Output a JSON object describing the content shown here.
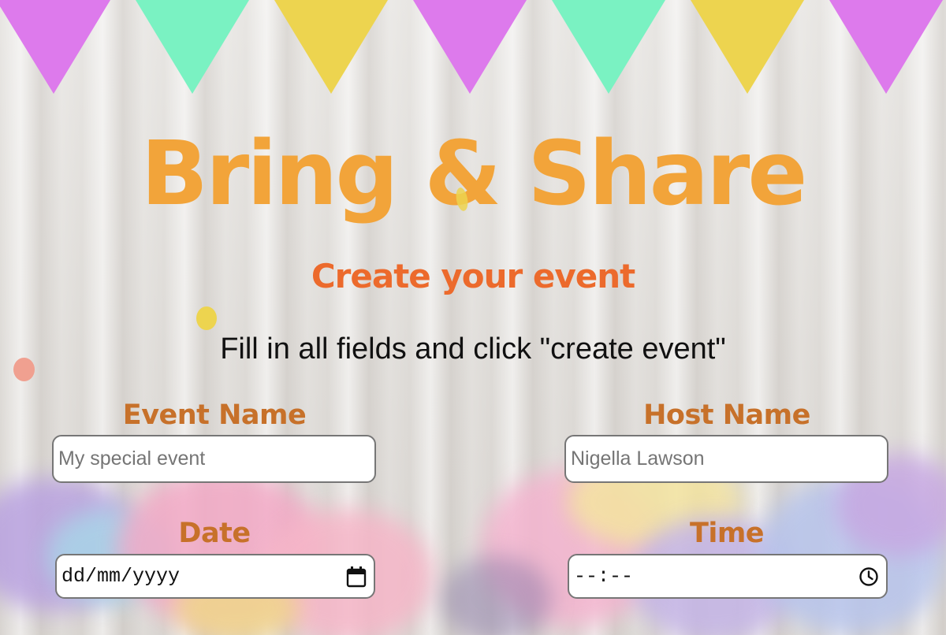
{
  "header": {
    "title": "Bring & Share",
    "subtitle": "Create your event",
    "instructions": "Fill in all fields and click \"create event\""
  },
  "form": {
    "event_name": {
      "label": "Event Name",
      "placeholder": "My special event",
      "value": ""
    },
    "host_name": {
      "label": "Host Name",
      "placeholder": "Nigella Lawson",
      "value": ""
    },
    "date": {
      "label": "Date",
      "display": "dd/mm/yyyy",
      "icon": "calendar-icon"
    },
    "time": {
      "label": "Time",
      "display": "--:--",
      "icon": "clock-icon"
    }
  },
  "decor": {
    "bunting_colors": [
      "#dd7aec",
      "#7af2c2",
      "#edd44f"
    ],
    "confetti_colors": [
      "#edd44f",
      "#f0a090"
    ]
  },
  "colors": {
    "title": "#f2a43a",
    "subtitle": "#ec6a2c",
    "label": "#c7712a"
  }
}
